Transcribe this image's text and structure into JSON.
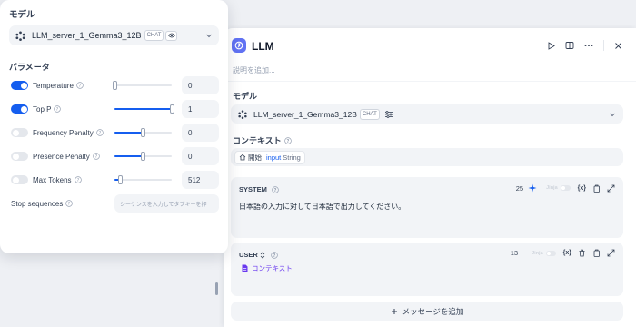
{
  "popover": {
    "model_label": "モデル",
    "model_name": "LLM_server_1_Gemma3_12B",
    "model_badge": "CHAT",
    "params_title": "パラメータ",
    "params": [
      {
        "name": "Temperature",
        "enabled": true,
        "value": "0",
        "level": 0.0
      },
      {
        "name": "Top P",
        "enabled": true,
        "value": "1",
        "level": 1.0
      },
      {
        "name": "Frequency Penalty",
        "enabled": false,
        "value": "0",
        "level": 0.5
      },
      {
        "name": "Presence Penalty",
        "enabled": false,
        "value": "0",
        "level": 0.5
      },
      {
        "name": "Max Tokens",
        "enabled": false,
        "value": "512",
        "level": 0.1
      }
    ],
    "stop_label": "Stop sequences",
    "stop_placeholder": "シーケンスを入力してタブキーを押"
  },
  "panel": {
    "title": "LLM",
    "description_placeholder": "説明を追加...",
    "model_label": "モデル",
    "model_name": "LLM_server_1_Gemma3_12B",
    "model_badge": "CHAT",
    "context_label": "コンテキスト",
    "context_node": "開始",
    "context_var": "input",
    "context_type": "String",
    "system": {
      "role": "SYSTEM",
      "count": "25",
      "jinja": "Jinja",
      "var_icon": "{x}",
      "text": "日本語の入力に対して日本語で出力してください。"
    },
    "user": {
      "role": "USER",
      "count": "13",
      "jinja": "Jinja",
      "var_icon": "{x}",
      "context_ref": "コンテキスト"
    },
    "add_message": "メッセージを追加"
  },
  "colors": {
    "accent": "#155eef",
    "llm_icon": "#6172f3",
    "context_ref": "#6938ef"
  }
}
